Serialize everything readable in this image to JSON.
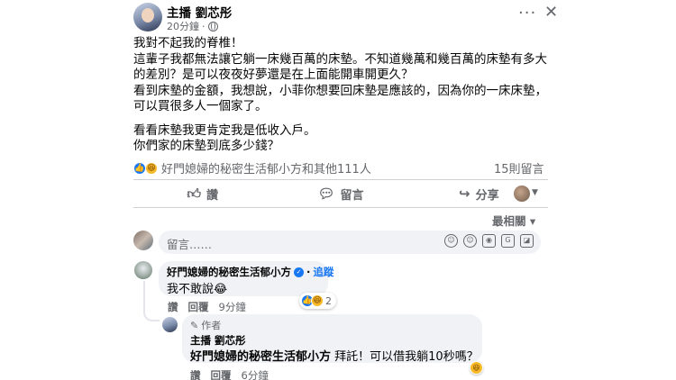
{
  "post": {
    "author": "主播 劉芯彤",
    "time": "20分鐘",
    "paragraphs": [
      "我對不起我的脊椎！",
      "這輩子我都無法讓它躺一床幾百萬的床墊。不知道幾萬和幾百萬的床墊有多大的差別？是可以夜夜好夢還是在上面能開車開更久？",
      "看到床墊的金額，我想說，小菲你想要回床墊是應該的，因為你的一床床墊，可以買很多人一個家了。",
      "看看床墊我更肯定我是低收入戶。",
      "你們家的床墊到底多少錢？"
    ],
    "reactions_summary": "好門媳婦的秘密生活郁小方和其他111人",
    "comment_count": "15則留言",
    "more_icon": "more-horizontal-icon",
    "close_icon": "close-icon"
  },
  "actions": {
    "like": "讚",
    "comment": "留言",
    "share": "分享"
  },
  "sort_label": "最相關",
  "comment_box": {
    "placeholder": "留言……"
  },
  "comments": [
    {
      "author": "好門媳婦的秘密生活郁小方",
      "follow": "追蹤",
      "text": "我不敢說😂",
      "reaction_count": "2",
      "like": "讚",
      "reply": "回覆",
      "time": "9分鐘"
    }
  ],
  "reply": {
    "badge": "作者",
    "author": "主播 劉芯彤",
    "tag": "好門媳婦的秘密生活郁小方",
    "text": " 拜託！可以借我躺10秒嗎？",
    "like": "讚",
    "reply": "回覆",
    "time": "6分鐘"
  },
  "colors": {
    "accent": "#1877f2",
    "muted": "#65676b",
    "bubble": "#f0f2f5",
    "haha": "#f7b928"
  }
}
